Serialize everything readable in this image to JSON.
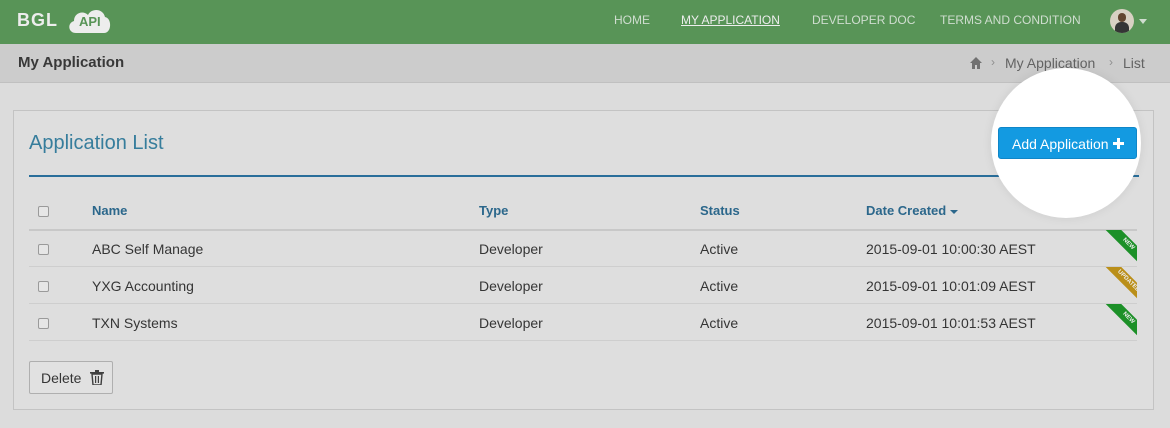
{
  "header": {
    "logo_text": "BGL",
    "logo_badge": "API",
    "nav": [
      {
        "label": "HOME",
        "active": false
      },
      {
        "label": "MY APPLICATION",
        "active": true
      },
      {
        "label": "DEVELOPER DOC",
        "active": false
      },
      {
        "label": "TERMS AND CONDITION",
        "active": false
      }
    ]
  },
  "subheader": {
    "title": "My Application",
    "breadcrumb": [
      {
        "label": "My Application"
      },
      {
        "label": "List"
      }
    ]
  },
  "panel": {
    "title": "Application List",
    "add_button": "Add Application",
    "columns": [
      "Name",
      "Type",
      "Status",
      "Date Created"
    ],
    "rows": [
      {
        "name": "ABC Self Manage",
        "type": "Developer",
        "status": "Active",
        "date": "2015-09-01 10:00:30 AEST",
        "ribbon": "NEW"
      },
      {
        "name": "YXG Accounting",
        "type": "Developer",
        "status": "Active",
        "date": "2015-09-01 10:01:09 AEST",
        "ribbon": "UPDATED"
      },
      {
        "name": "TXN Systems",
        "type": "Developer",
        "status": "Active",
        "date": "2015-09-01 10:01:53 AEST",
        "ribbon": "NEW"
      }
    ],
    "delete_button": "Delete"
  },
  "colors": {
    "header_green": "#5fa05e",
    "accent_blue": "#139ae1",
    "ribbon_new": "#1f9b2c",
    "ribbon_updated": "#c99a1b"
  }
}
